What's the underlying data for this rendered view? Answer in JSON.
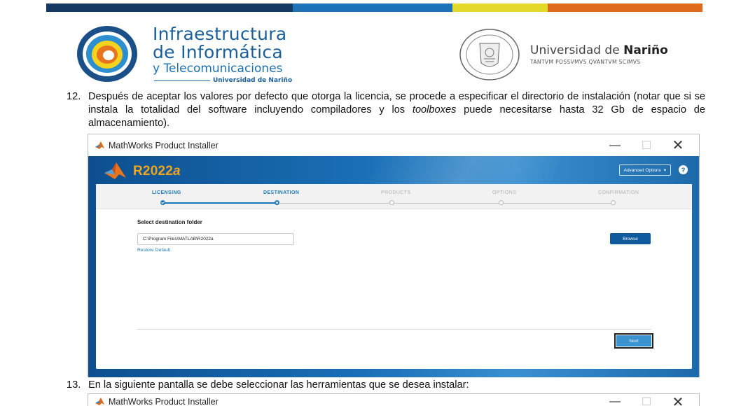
{
  "header": {
    "brand_line1": "Infraestructura",
    "brand_line2": "de Informática",
    "brand_line3": "y Telecomunicaciones",
    "brand_sub": "Universidad de Nariño",
    "university_name_light": "Universidad de ",
    "university_name_bold": "Nariño",
    "university_motto": "TANTVM POSSVMVS QVANTVM SCIMVS",
    "stripe_colors": [
      "#143a63",
      "#1e73b8",
      "#e3d92a",
      "#e06a1c"
    ]
  },
  "step12": {
    "number": "12.",
    "text_before": "Después de aceptar los valores por defecto que otorga la licencia, se procede a especificar el directorio de instalación (notar que si se instala la totalidad del software incluyendo compiladores y los ",
    "text_italic": "toolboxes",
    "text_after": " puede necesitarse hasta 32 Gb de espacio de almacenamiento)."
  },
  "installer": {
    "window_title": "MathWorks Product Installer",
    "minimize": "—",
    "maximize": "☐",
    "close": "✕",
    "release_prefix": "R2022",
    "release_suffix": "a",
    "advanced_options": "Advanced Options",
    "advanced_caret": "▾",
    "help": "?",
    "steps": [
      {
        "label": "LICENSING",
        "state": "done"
      },
      {
        "label": "DESTINATION",
        "state": "current"
      },
      {
        "label": "PRODUCTS",
        "state": "todo"
      },
      {
        "label": "OPTIONS",
        "state": "todo"
      },
      {
        "label": "CONFIRMATION",
        "state": "todo"
      }
    ],
    "folder_label": "Select destination folder",
    "folder_value": "C:\\Program Files\\MATLAB\\R2022a",
    "restore_default": "Restore Default",
    "browse_button": "Browse",
    "next_button": "Next",
    "accent_color": "#1a78b8",
    "release_color": "#f2a51c"
  },
  "step13": {
    "number": "13.",
    "text": "En la siguiente pantalla se debe seleccionar las herramientas que se desea instalar:"
  },
  "installer2": {
    "window_title": "MathWorks Product Installer",
    "minimize": "—",
    "maximize": "☐",
    "close": "✕"
  }
}
